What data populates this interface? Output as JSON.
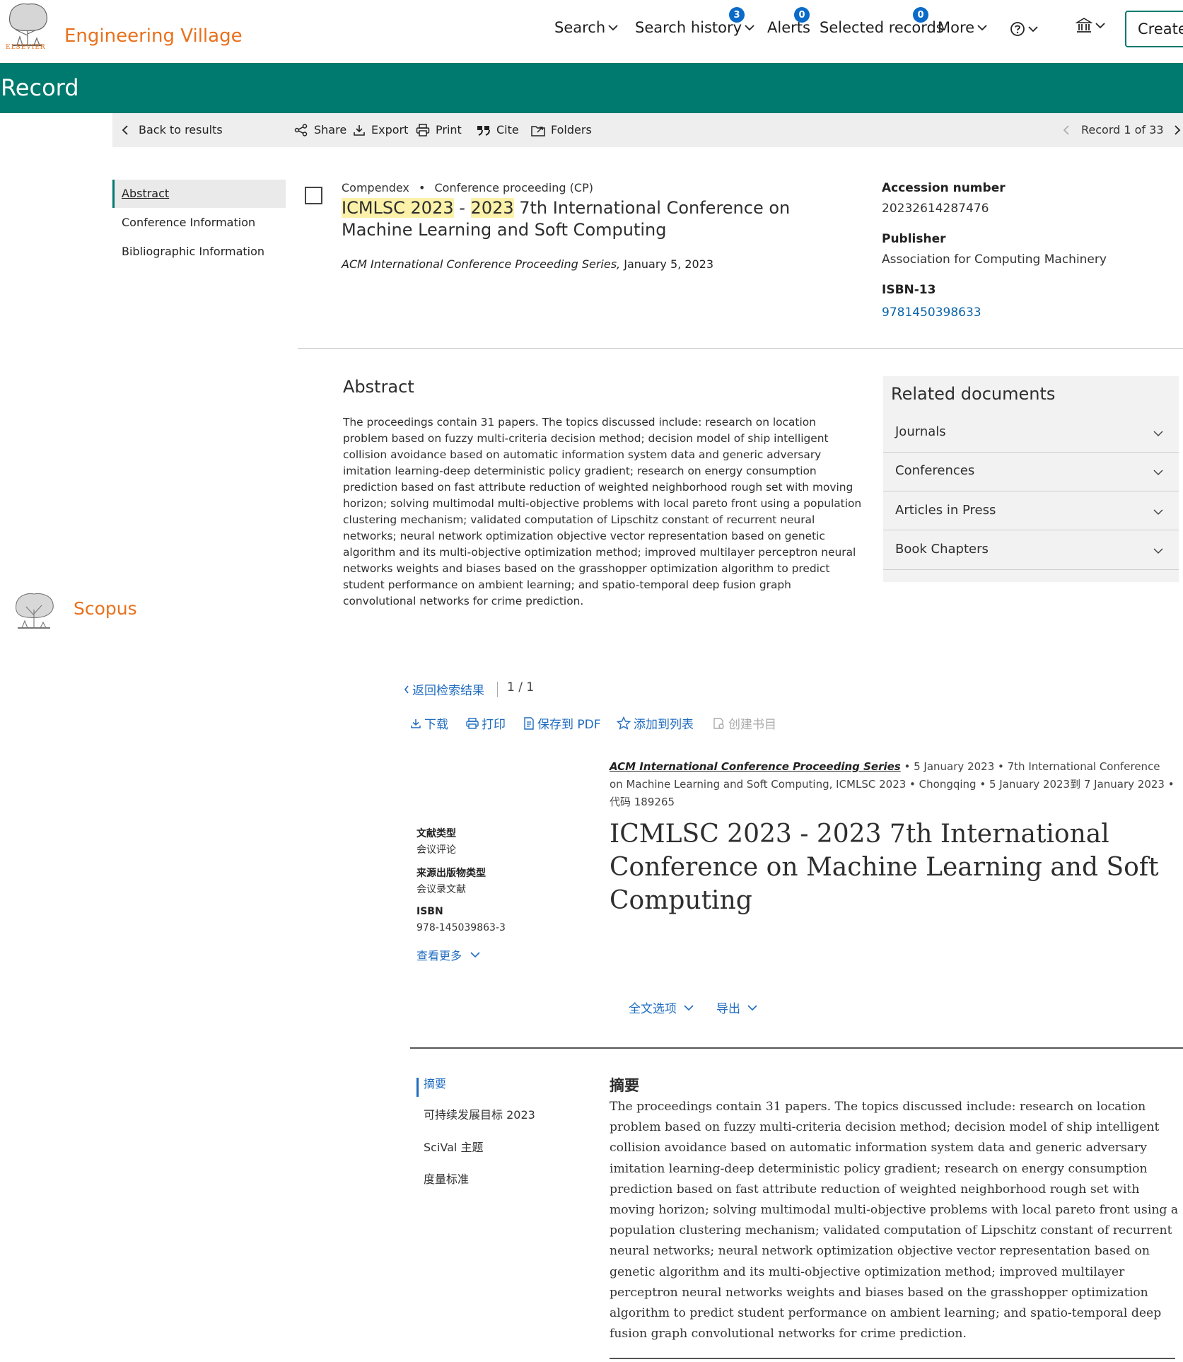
{
  "header": {
    "brand_top": "ELSEVIER",
    "brand": "Engineering Village",
    "nav": {
      "search": "Search",
      "search_history": "Search history",
      "search_history_count": "3",
      "alerts": "Alerts",
      "alerts_count": "0",
      "selected_records": "Selected records",
      "selected_records_count": "0",
      "more": "More"
    },
    "create_label": "Create"
  },
  "record_bar": {
    "title": "Record"
  },
  "toolbar": {
    "back": "Back to results",
    "share": "Share",
    "export": "Export",
    "print": "Print",
    "cite": "Cite",
    "folders": "Folders",
    "record_counter": "Record 1 of 33"
  },
  "left_nav": {
    "items": [
      "Abstract",
      "Conference Information",
      "Bibliographic Information"
    ]
  },
  "record": {
    "database": "Compendex",
    "doc_type": "Conference proceeding (CP)",
    "title_hl_1": "ICMLSC 2023",
    "title_sep": " - ",
    "title_hl_2": "2023",
    "title_rest": " 7th International Conference on Machine Learning and Soft Computing",
    "series": "ACM International Conference Proceeding Series,",
    "date": " January 5, 2023"
  },
  "metadata": {
    "accession_label": "Accession number",
    "accession_value": "20232614287476",
    "publisher_label": "Publisher",
    "publisher_value": "Association for Computing Machinery",
    "isbn_label": "ISBN-13",
    "isbn_value": "9781450398633"
  },
  "abstract": {
    "heading": "Abstract",
    "text": "The proceedings contain 31 papers. The topics discussed include: research on location problem based on fuzzy multi-criteria decision method; decision model of ship intelligent collision avoidance based on automatic information system data and generic adversary imitation learning-deep deterministic policy gradient; research on energy consumption prediction based on fast attribute reduction of weighted neighborhood rough set with moving horizon; solving multimodal multi-objective problems with local pareto front using a population clustering mechanism; validated computation of Lipschitz constant of recurrent neural networks; neural network optimization objective vector representation based on genetic algorithm and its multi-objective optimization method; improved multilayer perceptron neural networks weights and biases based on the grasshopper optimization algorithm to predict student performance on ambient learning; and spatio-temporal deep fusion graph convolutional networks for crime prediction."
  },
  "related": {
    "heading": "Related documents",
    "items": [
      "Journals",
      "Conferences",
      "Articles in Press",
      "Book Chapters"
    ]
  },
  "scopus": {
    "brand": "Scopus",
    "back_results": "返回检索结果",
    "pager": "1 / 1",
    "actions": {
      "download": "下载",
      "print": "打印",
      "save_pdf": "保存到 PDF",
      "add_list": "添加到列表",
      "create_bib": "创建书目"
    },
    "series": "ACM International Conference Proceeding Series",
    "source_rest": " • 5 January 2023 • 7th International Conference on Machine Learning and Soft Computing, ICMLSC 2023 • Chongqing • 5 January 2023到 7 January 2023 • 代码 189265",
    "doc_type_label": "文献类型",
    "doc_type_value": "会议评论",
    "source_type_label": "来源出版物类型",
    "source_type_value": "会议录文献",
    "isbn_label": "ISBN",
    "isbn_value": "978-145039863-3",
    "see_more": "查看更多",
    "title": "ICMLSC 2023 - 2023 7th International Conference on Machine Learning and Soft Computing",
    "fulltext_options": "全文选项",
    "export": "导出",
    "nav_items": [
      "摘要",
      "可持续发展目标 2023",
      "SciVal 主题",
      "度量标准"
    ],
    "abstract_heading": "摘要",
    "abstract_text": "The proceedings contain 31 papers. The topics discussed include: research on location problem based on fuzzy multi-criteria decision method; decision model of ship intelligent collision avoidance based on automatic information system data and generic adversary imitation learning-deep deterministic policy gradient; research on energy consumption prediction based on fast attribute reduction of weighted neighborhood rough set with moving horizon; solving multimodal multi-objective problems with local pareto front using a population clustering mechanism; validated computation of Lipschitz constant of recurrent neural networks; neural network optimization objective vector representation based on genetic algorithm and its multi-objective optimization method; improved multilayer perceptron neural networks weights and biases based on the grasshopper optimization algorithm to predict student performance on ambient learning; and spatio-temporal deep fusion graph convolutional networks for crime prediction."
  },
  "colors": {
    "brand_orange": "#e9711c",
    "record_green": "#007a6e",
    "badge_blue": "#0a6bc8",
    "highlight": "#fbf1a9",
    "link_blue": "#1f6cc0"
  }
}
